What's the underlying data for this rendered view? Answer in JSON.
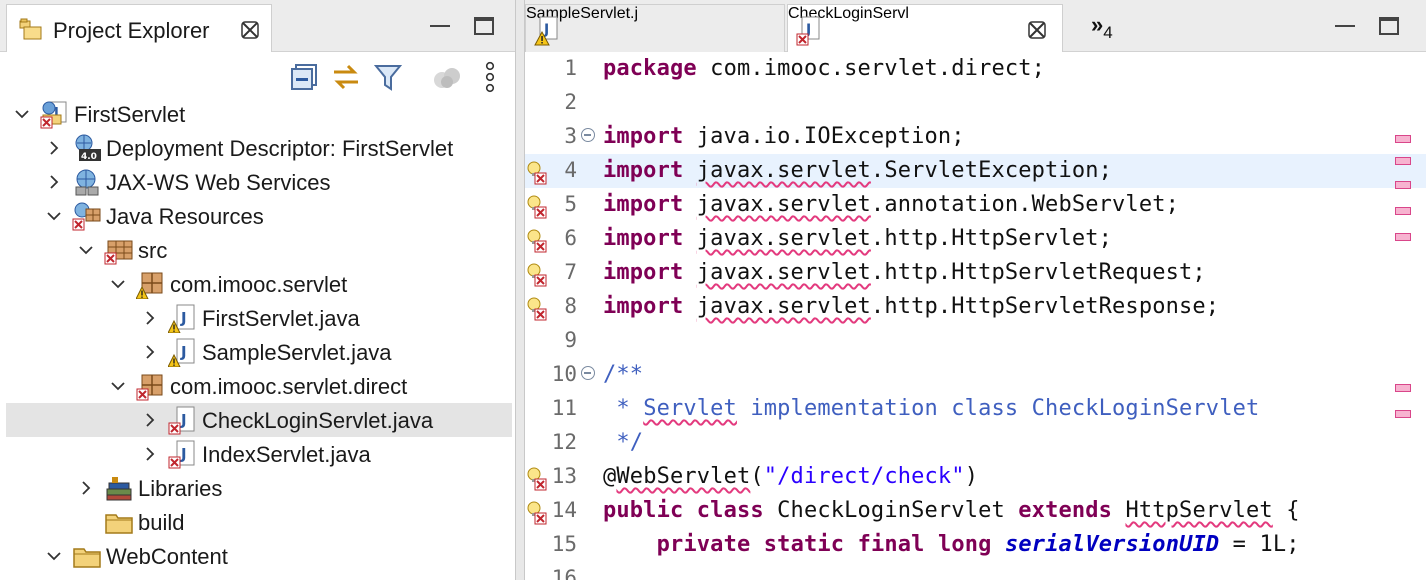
{
  "explorer": {
    "title": "Project Explorer",
    "tree": [
      {
        "label": "FirstServlet",
        "level": 0,
        "expanded": true,
        "icon": "web-project-icon",
        "error": true
      },
      {
        "label": "Deployment Descriptor: FirstServlet",
        "level": 1,
        "expanded": false,
        "icon": "deployment-descriptor-icon"
      },
      {
        "label": "JAX-WS Web Services",
        "level": 1,
        "expanded": false,
        "icon": "jaxws-icon"
      },
      {
        "label": "Java Resources",
        "level": 1,
        "expanded": true,
        "icon": "java-resources-icon",
        "error": true
      },
      {
        "label": "src",
        "level": 2,
        "expanded": true,
        "icon": "source-folder-icon",
        "error": true
      },
      {
        "label": "com.imooc.servlet",
        "level": 3,
        "expanded": true,
        "icon": "package-icon",
        "warning": true
      },
      {
        "label": "FirstServlet.java",
        "level": 4,
        "expanded": false,
        "icon": "java-file-icon",
        "warning": true
      },
      {
        "label": "SampleServlet.java",
        "level": 4,
        "expanded": false,
        "icon": "java-file-icon",
        "warning": true
      },
      {
        "label": "com.imooc.servlet.direct",
        "level": 3,
        "expanded": true,
        "icon": "package-icon",
        "error": true
      },
      {
        "label": "CheckLoginServlet.java",
        "level": 4,
        "expanded": false,
        "icon": "java-file-icon",
        "error": true,
        "selected": true
      },
      {
        "label": "IndexServlet.java",
        "level": 4,
        "expanded": false,
        "icon": "java-file-icon",
        "error": true
      },
      {
        "label": "Libraries",
        "level": 2,
        "expanded": false,
        "icon": "libraries-icon"
      },
      {
        "label": "build",
        "level": 2,
        "expanded": null,
        "icon": "folder-icon"
      },
      {
        "label": "WebContent",
        "level": 1,
        "expanded": true,
        "icon": "folder-icon"
      }
    ]
  },
  "editor": {
    "tabs": [
      {
        "label": "SampleServlet.j",
        "state": "warning",
        "active": false
      },
      {
        "label": "CheckLoginServl",
        "state": "error",
        "active": true
      }
    ],
    "overflow_label": "»",
    "overflow_count": "4",
    "lines": [
      {
        "n": "1",
        "parts": [
          [
            "kw",
            "package"
          ],
          [
            "",
            " com.imooc.servlet.direct;"
          ]
        ]
      },
      {
        "n": "2",
        "parts": []
      },
      {
        "n": "3",
        "fold": true,
        "parts": [
          [
            "kw",
            "import"
          ],
          [
            "",
            " java.io.IOException;"
          ]
        ]
      },
      {
        "n": "4",
        "marker": "error",
        "hl": true,
        "parts": [
          [
            "kw",
            "import"
          ],
          [
            "",
            " "
          ],
          [
            "err",
            "javax.servlet"
          ],
          [
            "",
            ".ServletException;"
          ]
        ]
      },
      {
        "n": "5",
        "marker": "error",
        "parts": [
          [
            "kw",
            "import"
          ],
          [
            "",
            " "
          ],
          [
            "err",
            "javax.servlet"
          ],
          [
            "",
            ".annotation.WebServlet;"
          ]
        ]
      },
      {
        "n": "6",
        "marker": "error",
        "parts": [
          [
            "kw",
            "import"
          ],
          [
            "",
            " "
          ],
          [
            "err",
            "javax.servlet"
          ],
          [
            "",
            ".http.HttpServlet;"
          ]
        ]
      },
      {
        "n": "7",
        "marker": "error",
        "parts": [
          [
            "kw",
            "import"
          ],
          [
            "",
            " "
          ],
          [
            "err",
            "javax.servlet"
          ],
          [
            "",
            ".http.HttpServletRequest;"
          ]
        ]
      },
      {
        "n": "8",
        "marker": "error",
        "parts": [
          [
            "kw",
            "import"
          ],
          [
            "",
            " "
          ],
          [
            "err",
            "javax.servlet"
          ],
          [
            "",
            ".http.HttpServletResponse;"
          ]
        ]
      },
      {
        "n": "9",
        "parts": []
      },
      {
        "n": "10",
        "fold": true,
        "parts": [
          [
            "cm",
            "/**"
          ]
        ]
      },
      {
        "n": "11",
        "parts": [
          [
            "cm",
            " * "
          ],
          [
            "cm err",
            "Servlet"
          ],
          [
            "cm",
            " implementation class CheckLoginServlet"
          ]
        ]
      },
      {
        "n": "12",
        "parts": [
          [
            "cm",
            " */"
          ]
        ]
      },
      {
        "n": "13",
        "marker": "error",
        "parts": [
          [
            "",
            "@"
          ],
          [
            "err",
            "WebServlet"
          ],
          [
            "",
            "("
          ],
          [
            "str",
            "\"/direct/check\""
          ],
          [
            "",
            ")"
          ]
        ]
      },
      {
        "n": "14",
        "marker": "error",
        "parts": [
          [
            "kw",
            "public"
          ],
          [
            "",
            " "
          ],
          [
            "kw",
            "class"
          ],
          [
            "",
            " CheckLoginServlet "
          ],
          [
            "kw",
            "extends"
          ],
          [
            "",
            " "
          ],
          [
            "err",
            "HttpServlet"
          ],
          [
            "",
            " {"
          ]
        ]
      },
      {
        "n": "15",
        "parts": [
          [
            "",
            "    "
          ],
          [
            "kw",
            "private"
          ],
          [
            "",
            " "
          ],
          [
            "kw",
            "static"
          ],
          [
            "",
            " "
          ],
          [
            "kw",
            "final"
          ],
          [
            "",
            " "
          ],
          [
            "kw",
            "long"
          ],
          [
            "",
            " "
          ],
          [
            "fld",
            "serialVersionUID"
          ],
          [
            "",
            " = 1L;"
          ]
        ]
      },
      {
        "n": "16",
        "parts": []
      }
    ],
    "overview_marks": [
      135,
      157,
      181,
      207,
      233,
      384,
      410
    ]
  }
}
